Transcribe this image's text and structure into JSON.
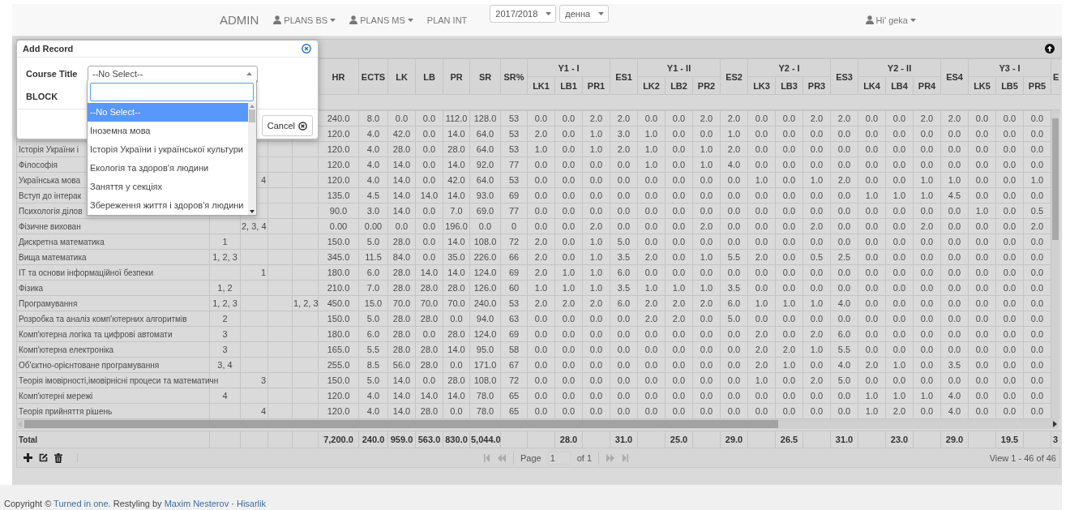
{
  "navbar": {
    "brand": "ADMIN",
    "menus": [
      {
        "label": "PLANS BS",
        "kind": "dropdown"
      },
      {
        "label": "PLANS MS",
        "kind": "dropdown"
      },
      {
        "label": "PLAN INT",
        "kind": "link"
      }
    ],
    "selects": [
      {
        "value": "2017/2018"
      },
      {
        "value": "денна"
      }
    ],
    "user": {
      "label": "Hi' geka"
    }
  },
  "grid": {
    "header": [
      {
        "label": "HR"
      },
      {
        "label": "ECTS"
      },
      {
        "label": "LK"
      },
      {
        "label": "LB"
      },
      {
        "label": "PR"
      },
      {
        "label": "SR"
      },
      {
        "label": "SR%"
      },
      {
        "label": "Y1 - I",
        "children": [
          "LK1",
          "LB1",
          "PR1"
        ]
      },
      {
        "label": "ES1"
      },
      {
        "label": "Y1 - II",
        "children": [
          "LK2",
          "LB2",
          "PR2"
        ]
      },
      {
        "label": "ES2"
      },
      {
        "label": "Y2 - I",
        "children": [
          "LK3",
          "LB3",
          "PR3"
        ]
      },
      {
        "label": "ES3"
      },
      {
        "label": "Y2 - II",
        "children": [
          "LK4",
          "LB4",
          "PR4"
        ]
      },
      {
        "label": "ES4"
      },
      {
        "label": "Y3 - I",
        "children": [
          "LK5",
          "LB5",
          "PR5"
        ]
      },
      {
        "label": "E"
      }
    ],
    "rows": [
      {
        "values": [
          "240.0",
          "8.0",
          "0.0",
          "0.0",
          "112.0",
          "128.0",
          "53",
          "0.0",
          "0.0",
          "2.0",
          "2.0",
          "0.0",
          "0.0",
          "2.0",
          "2.0",
          "0.0",
          "0.0",
          "2.0",
          "2.0",
          "0.0",
          "0.0",
          "2.0",
          "2.0",
          "0.0",
          "0.0",
          "0.0"
        ]
      },
      {
        "values": [
          "120.0",
          "4.0",
          "42.0",
          "0.0",
          "14.0",
          "64.0",
          "53",
          "2.0",
          "0.0",
          "1.0",
          "3.0",
          "1.0",
          "0.0",
          "0.0",
          "1.0",
          "0.0",
          "0.0",
          "0.0",
          "0.0",
          "0.0",
          "0.0",
          "0.0",
          "0.0",
          "0.0",
          "0.0",
          "0.0"
        ]
      },
      {
        "name": "Історія України і",
        "values": [
          "120.0",
          "4.0",
          "28.0",
          "0.0",
          "28.0",
          "64.0",
          "53",
          "1.0",
          "0.0",
          "1.0",
          "2.0",
          "1.0",
          "0.0",
          "1.0",
          "2.0",
          "0.0",
          "0.0",
          "0.0",
          "0.0",
          "0.0",
          "0.0",
          "0.0",
          "0.0",
          "0.0",
          "0.0",
          "0.0"
        ]
      },
      {
        "name": "Філософія",
        "values": [
          "120.0",
          "4.0",
          "14.0",
          "0.0",
          "14.0",
          "92.0",
          "77",
          "0.0",
          "0.0",
          "0.0",
          "0.0",
          "1.0",
          "0.0",
          "1.0",
          "4.0",
          "0.0",
          "0.0",
          "0.0",
          "0.0",
          "0.0",
          "0.0",
          "0.0",
          "0.0",
          "0.0",
          "0.0",
          "0.0"
        ]
      },
      {
        "name": "Українська мова",
        "column_3": "4",
        "values": [
          "120.0",
          "4.0",
          "14.0",
          "0.0",
          "42.0",
          "64.0",
          "53",
          "0.0",
          "0.0",
          "0.0",
          "0.0",
          "0.0",
          "0.0",
          "0.0",
          "0.0",
          "1.0",
          "0.0",
          "1.0",
          "2.0",
          "0.0",
          "0.0",
          "1.0",
          "1.0",
          "0.0",
          "0.0",
          "1.0"
        ]
      },
      {
        "name": "Вступ до інтерак",
        "values": [
          "135.0",
          "4.5",
          "14.0",
          "14.0",
          "14.0",
          "93.0",
          "69",
          "0.0",
          "0.0",
          "0.0",
          "0.0",
          "0.0",
          "0.0",
          "0.0",
          "0.0",
          "0.0",
          "0.0",
          "0.0",
          "0.0",
          "1.0",
          "1.0",
          "1.0",
          "4.5",
          "0.0",
          "0.0",
          "0.0"
        ]
      },
      {
        "name": "Психологія ділов",
        "values": [
          "90.0",
          "3.0",
          "14.0",
          "0.0",
          "7.0",
          "69.0",
          "77",
          "0.0",
          "0.0",
          "0.0",
          "0.0",
          "0.0",
          "0.0",
          "0.0",
          "0.0",
          "0.0",
          "0.0",
          "0.0",
          "0.0",
          "0.0",
          "0.0",
          "0.0",
          "0.0",
          "1.0",
          "0.0",
          "0.5"
        ]
      },
      {
        "name": "Фізичне вихован",
        "column_3": "2, 3, 4",
        "values": [
          "0.00",
          "0.00",
          "0.0",
          "0.0",
          "196.0",
          "0.0",
          "0",
          "0.0",
          "0.0",
          "2.0",
          "0.0",
          "0.0",
          "0.0",
          "2.0",
          "0.0",
          "0.0",
          "0.0",
          "2.0",
          "0.0",
          "0.0",
          "0.0",
          "2.0",
          "0.0",
          "0.0",
          "0.0",
          "2.0"
        ]
      },
      {
        "name": "Дискретна математика",
        "column_2": "1",
        "values": [
          "150.0",
          "5.0",
          "28.0",
          "0.0",
          "14.0",
          "108.0",
          "72",
          "2.0",
          "0.0",
          "1.0",
          "5.0",
          "0.0",
          "0.0",
          "0.0",
          "0.0",
          "0.0",
          "0.0",
          "0.0",
          "0.0",
          "0.0",
          "0.0",
          "0.0",
          "0.0",
          "0.0",
          "0.0",
          "0.0"
        ]
      },
      {
        "name": "Вища математика",
        "column_2": "1, 2, 3",
        "values": [
          "345.0",
          "11.5",
          "84.0",
          "0.0",
          "35.0",
          "226.0",
          "66",
          "2.0",
          "0.0",
          "1.0",
          "3.5",
          "2.0",
          "0.0",
          "1.0",
          "5.5",
          "2.0",
          "0.0",
          "0.5",
          "2.5",
          "0.0",
          "0.0",
          "0.0",
          "0.0",
          "0.0",
          "0.0",
          "0.0"
        ]
      },
      {
        "name": "ІТ та основи інформаційної безпеки",
        "column_3": "1",
        "values": [
          "180.0",
          "6.0",
          "28.0",
          "14.0",
          "14.0",
          "124.0",
          "69",
          "2.0",
          "1.0",
          "1.0",
          "6.0",
          "0.0",
          "0.0",
          "0.0",
          "0.0",
          "0.0",
          "0.0",
          "0.0",
          "0.0",
          "0.0",
          "0.0",
          "0.0",
          "0.0",
          "0.0",
          "0.0",
          "0.0"
        ]
      },
      {
        "name": "Фізика",
        "column_2": "1, 2",
        "values": [
          "210.0",
          "7.0",
          "28.0",
          "28.0",
          "28.0",
          "126.0",
          "60",
          "1.0",
          "1.0",
          "1.0",
          "3.5",
          "1.0",
          "1.0",
          "1.0",
          "3.5",
          "0.0",
          "0.0",
          "0.0",
          "0.0",
          "0.0",
          "0.0",
          "0.0",
          "0.0",
          "0.0",
          "0.0",
          "0.0"
        ]
      },
      {
        "name": "Програмування",
        "column_2": "1, 2, 3",
        "column_5": "1, 2, 3",
        "values": [
          "450.0",
          "15.0",
          "70.0",
          "70.0",
          "70.0",
          "240.0",
          "53",
          "2.0",
          "2.0",
          "2.0",
          "6.0",
          "2.0",
          "2.0",
          "2.0",
          "6.0",
          "1.0",
          "1.0",
          "1.0",
          "4.0",
          "0.0",
          "0.0",
          "0.0",
          "0.0",
          "0.0",
          "0.0",
          "0.0"
        ]
      },
      {
        "name": "Розробка та аналіз комп'ютерних алгоритмів",
        "column_2": "2",
        "values": [
          "150.0",
          "5.0",
          "28.0",
          "28.0",
          "0.0",
          "94.0",
          "63",
          "0.0",
          "0.0",
          "0.0",
          "0.0",
          "2.0",
          "2.0",
          "0.0",
          "5.0",
          "0.0",
          "0.0",
          "0.0",
          "0.0",
          "0.0",
          "0.0",
          "0.0",
          "0.0",
          "0.0",
          "0.0",
          "0.0"
        ]
      },
      {
        "name": "Комп'ютерна логіка та цифрові автомати",
        "column_2": "3",
        "values": [
          "180.0",
          "6.0",
          "28.0",
          "0.0",
          "28.0",
          "124.0",
          "69",
          "0.0",
          "0.0",
          "0.0",
          "0.0",
          "0.0",
          "0.0",
          "0.0",
          "0.0",
          "2.0",
          "0.0",
          "2.0",
          "6.0",
          "0.0",
          "0.0",
          "0.0",
          "0.0",
          "0.0",
          "0.0",
          "0.0"
        ]
      },
      {
        "name": "Комп'ютерна електроніка",
        "column_2": "3",
        "values": [
          "165.0",
          "5.5",
          "28.0",
          "28.0",
          "14.0",
          "95.0",
          "58",
          "0.0",
          "0.0",
          "0.0",
          "0.0",
          "0.0",
          "0.0",
          "0.0",
          "0.0",
          "2.0",
          "2.0",
          "1.0",
          "5.5",
          "0.0",
          "0.0",
          "0.0",
          "0.0",
          "0.0",
          "0.0",
          "0.0"
        ]
      },
      {
        "name": "Об'єктно-орієнтоване програмування",
        "column_2": "3, 4",
        "values": [
          "255.0",
          "8.5",
          "56.0",
          "28.0",
          "0.0",
          "171.0",
          "67",
          "0.0",
          "0.0",
          "0.0",
          "0.0",
          "0.0",
          "0.0",
          "0.0",
          "0.0",
          "2.0",
          "1.0",
          "0.0",
          "4.0",
          "2.0",
          "1.0",
          "0.0",
          "3.5",
          "0.0",
          "0.0",
          "0.0"
        ]
      },
      {
        "name": "Теорія імовірності,імовірнісні процеси та математичн",
        "column_3": "3",
        "values": [
          "150.0",
          "5.0",
          "14.0",
          "0.0",
          "28.0",
          "108.0",
          "72",
          "0.0",
          "0.0",
          "0.0",
          "0.0",
          "0.0",
          "0.0",
          "0.0",
          "0.0",
          "1.0",
          "0.0",
          "2.0",
          "5.0",
          "0.0",
          "0.0",
          "0.0",
          "0.0",
          "0.0",
          "0.0",
          "0.0"
        ]
      },
      {
        "name": "Комп'ютерні мережі",
        "column_2": "4",
        "values": [
          "120.0",
          "4.0",
          "14.0",
          "14.0",
          "14.0",
          "78.0",
          "65",
          "0.0",
          "0.0",
          "0.0",
          "0.0",
          "0.0",
          "0.0",
          "0.0",
          "0.0",
          "0.0",
          "0.0",
          "0.0",
          "0.0",
          "1.0",
          "1.0",
          "1.0",
          "4.0",
          "0.0",
          "0.0",
          "0.0"
        ]
      },
      {
        "name": "Теорія прийняття рішень",
        "column_3": "4",
        "values": [
          "120.0",
          "4.0",
          "14.0",
          "28.0",
          "0.0",
          "78.0",
          "65",
          "0.0",
          "0.0",
          "0.0",
          "0.0",
          "0.0",
          "0.0",
          "0.0",
          "0.0",
          "0.0",
          "0.0",
          "0.0",
          "0.0",
          "1.0",
          "2.0",
          "0.0",
          "4.0",
          "0.0",
          "0.0",
          "0.0"
        ]
      }
    ],
    "totals": {
      "label": "Total",
      "values": [
        "7,200.0",
        "240.0",
        "959.0",
        "563.0",
        "830.0",
        "5,044.0"
      ],
      "group_totals": [
        {
          "lb": "28.0",
          "es": "31.0"
        },
        {
          "lb": "25.0",
          "es": "29.0"
        },
        {
          "lb": "26.5",
          "es": "31.0"
        },
        {
          "lb": "23.0",
          "es": "29.0"
        },
        {
          "lb": "19.5",
          "es": "3"
        }
      ]
    },
    "pager": {
      "page_label": "Page",
      "page": "1",
      "of": "of 1",
      "view": "View 1 - 46 of 46"
    }
  },
  "dialog": {
    "title": "Add Record",
    "fields": [
      {
        "label": "Course Title",
        "value": "--No Select--"
      },
      {
        "label": "BLOCK"
      }
    ],
    "cancel": "Cancel",
    "dropdown": {
      "options": [
        {
          "label": "--No Select--",
          "selected": true
        },
        {
          "label": "Іноземна мова",
          "selected": false
        },
        {
          "label": "Історія України і української культури",
          "selected": false
        },
        {
          "label": "Екологія та здоров'я людини",
          "selected": false
        },
        {
          "label": "Заняття у секціях",
          "selected": false
        },
        {
          "label": "Збереження життя і здоров'я людини",
          "selected": false
        }
      ]
    }
  },
  "footer": [
    {
      "text": "Copyright ©",
      "kind": "text"
    },
    {
      "text": "Turned in one.",
      "kind": "link"
    },
    {
      "text": "Restyling by",
      "kind": "text"
    },
    {
      "text": "Maxim Nesterov",
      "kind": "link"
    },
    {
      "text": "·",
      "kind": "text"
    },
    {
      "text": "Hisarlik",
      "kind": "link"
    }
  ]
}
